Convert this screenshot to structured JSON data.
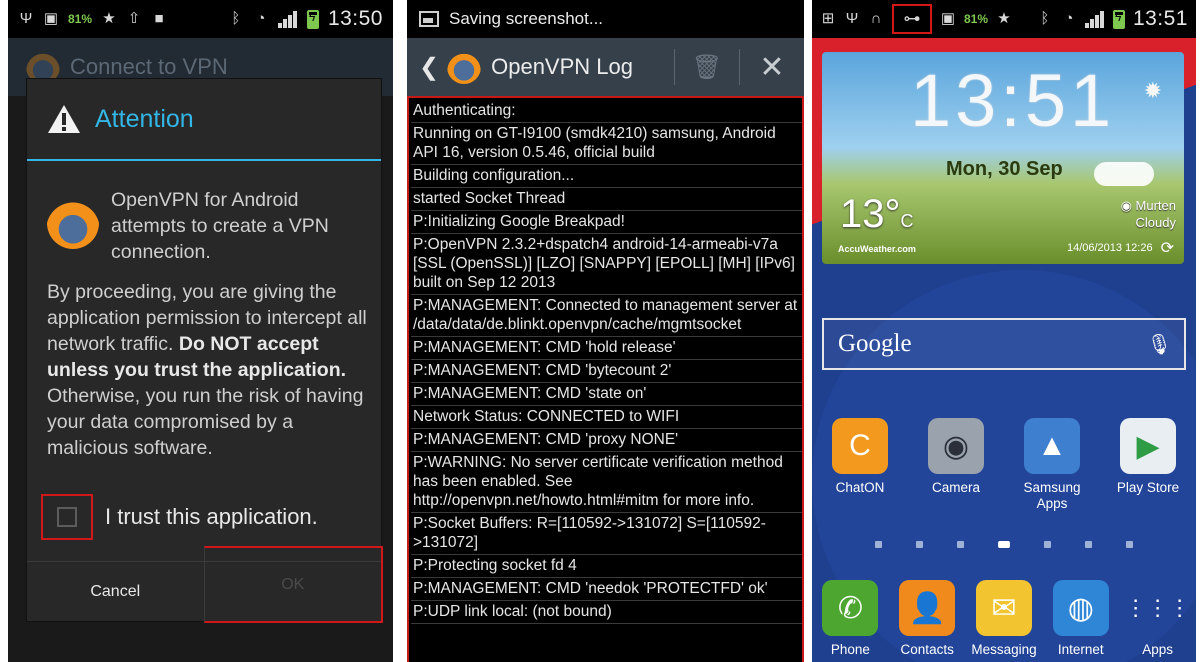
{
  "screen1": {
    "status": {
      "battery_pct": "81%",
      "time": "13:50"
    },
    "appbar_title": "Connect to VPN",
    "dialog": {
      "title": "Attention",
      "message": "OpenVPN for Android attempts to create a VPN connection.",
      "body_part1": "By proceeding, you are giving the application permission to intercept all network traffic. ",
      "body_bold": "Do NOT accept unless you trust the application.",
      "body_part2": " Otherwise, you run the risk of having your data compromised by a malicious software.",
      "checkbox_label": "I trust this application.",
      "checkbox_checked": false,
      "cancel_label": "Cancel",
      "ok_label": "OK"
    }
  },
  "screen2": {
    "notification": "Saving screenshot...",
    "title": "OpenVPN Log",
    "log_lines": [
      "Authenticating:",
      "Running on GT-I9100 (smdk4210) samsung, Android API 16, version 0.5.46, official build",
      "Building configuration...",
      "started Socket Thread",
      "P:Initializing Google Breakpad!",
      "P:OpenVPN 2.3.2+dspatch4 android-14-armeabi-v7a [SSL (OpenSSL)] [LZO] [SNAPPY] [EPOLL] [MH] [IPv6] built on Sep 12 2013",
      "P:MANAGEMENT: Connected to management server at /data/data/de.blinkt.openvpn/cache/mgmtsocket",
      "P:MANAGEMENT: CMD 'hold release'",
      "P:MANAGEMENT: CMD 'bytecount 2'",
      "P:MANAGEMENT: CMD 'state on'",
      "Network Status: CONNECTED  to WIFI",
      "P:MANAGEMENT: CMD 'proxy NONE'",
      "P:WARNING: No server certificate verification method has been enabled.  See http://openvpn.net/howto.html#mitm for more info.",
      "P:Socket Buffers: R=[110592->131072] S=[110592->131072]",
      "P:Protecting socket fd 4",
      "P:MANAGEMENT: CMD 'needok 'PROTECTFD' ok'",
      "P:UDP link local: (not bound)"
    ]
  },
  "screen3": {
    "status": {
      "battery_pct": "81%",
      "time": "13:51"
    },
    "widget": {
      "clock": "13:51",
      "date": "Mon, 30 Sep",
      "temp": "13°",
      "temp_unit": "C",
      "location": "Murten",
      "condition": "Cloudy",
      "provider": "AccuWeather.com",
      "updated": "14/06/2013 12:26"
    },
    "search_label": "Google",
    "apps": [
      {
        "label": "ChatON",
        "color": "#f39a1e",
        "glyph": "C"
      },
      {
        "label": "Camera",
        "color": "#9aa3ad",
        "glyph": "◉"
      },
      {
        "label": "Samsung Apps",
        "color": "#3e7fd0",
        "glyph": "▲"
      },
      {
        "label": "Play Store",
        "color": "#e9eef3",
        "glyph": "▶"
      }
    ],
    "dock": [
      {
        "label": "Phone",
        "color": "#4da62f",
        "glyph": "✆"
      },
      {
        "label": "Contacts",
        "color": "#f08a1c",
        "glyph": "👤"
      },
      {
        "label": "Messaging",
        "color": "#f2c530",
        "glyph": "✉"
      },
      {
        "label": "Internet",
        "color": "#2f86d6",
        "glyph": "◍"
      },
      {
        "label": "Apps",
        "color": "transparent",
        "glyph": "⋮⋮⋮"
      }
    ],
    "page_count": 7,
    "active_page": 4
  },
  "colors": {
    "accent": "#33b5e5",
    "highlight": "#d01818"
  }
}
